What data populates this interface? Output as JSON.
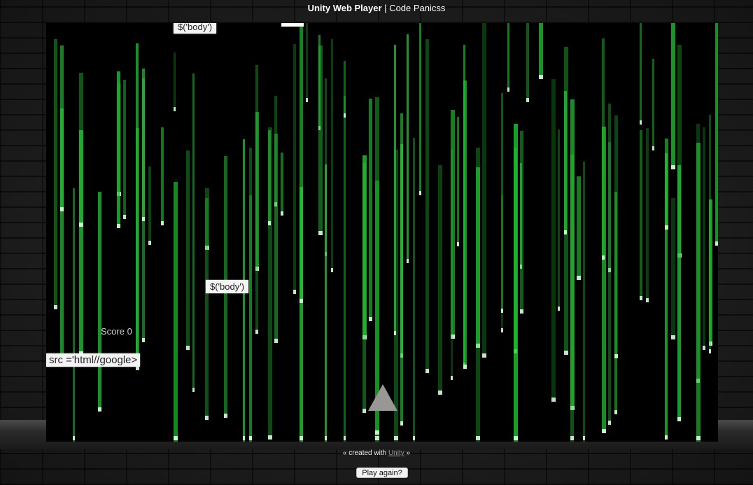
{
  "header": {
    "title_bold": "Unity Web Player",
    "title_separator": "|",
    "title_rest": "Code Panicss"
  },
  "game": {
    "code_blocks": [
      "$('body')",
      "$('body')",
      "src ='html//google>"
    ],
    "score_label": "Score 0",
    "rain_color": "#22c934",
    "background_color": "#000000"
  },
  "footer": {
    "prefix": "« created with",
    "link_text": "Unity",
    "suffix": "»"
  },
  "buttons": {
    "play_again": "Play again?"
  }
}
